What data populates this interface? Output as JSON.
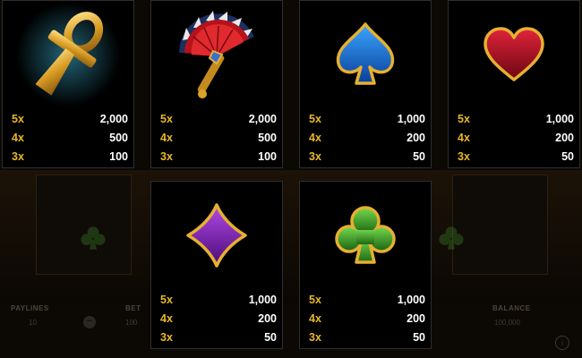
{
  "paytable": [
    {
      "symbol_icon": "ankh-icon",
      "payouts": [
        {
          "multiplier": "5x",
          "amount": "2,000"
        },
        {
          "multiplier": "4x",
          "amount": "500"
        },
        {
          "multiplier": "3x",
          "amount": "100"
        }
      ]
    },
    {
      "symbol_icon": "hand-fan-icon",
      "payouts": [
        {
          "multiplier": "5x",
          "amount": "2,000"
        },
        {
          "multiplier": "4x",
          "amount": "500"
        },
        {
          "multiplier": "3x",
          "amount": "100"
        }
      ]
    },
    {
      "symbol_icon": "spade-icon",
      "payouts": [
        {
          "multiplier": "5x",
          "amount": "1,000"
        },
        {
          "multiplier": "4x",
          "amount": "200"
        },
        {
          "multiplier": "3x",
          "amount": "50"
        }
      ]
    },
    {
      "symbol_icon": "heart-icon",
      "payouts": [
        {
          "multiplier": "5x",
          "amount": "1,000"
        },
        {
          "multiplier": "4x",
          "amount": "200"
        },
        {
          "multiplier": "3x",
          "amount": "50"
        }
      ]
    },
    {
      "symbol_icon": "diamond-icon",
      "payouts": [
        {
          "multiplier": "5x",
          "amount": "1,000"
        },
        {
          "multiplier": "4x",
          "amount": "200"
        },
        {
          "multiplier": "3x",
          "amount": "50"
        }
      ]
    },
    {
      "symbol_icon": "club-icon",
      "payouts": [
        {
          "multiplier": "5x",
          "amount": "1,000"
        },
        {
          "multiplier": "4x",
          "amount": "200"
        },
        {
          "multiplier": "3x",
          "amount": "50"
        }
      ]
    }
  ],
  "footer": {
    "paylines_label": "PAYLINES",
    "paylines_value": "10",
    "bet_label": "BET",
    "bet_value": "100",
    "balance_label": "BALANCE",
    "balance_value": "100,000"
  },
  "colors": {
    "multiplier": "#e9b826",
    "amount": "#ffffff",
    "card_bg": "#000000",
    "card_border": "#2e2e2e"
  }
}
